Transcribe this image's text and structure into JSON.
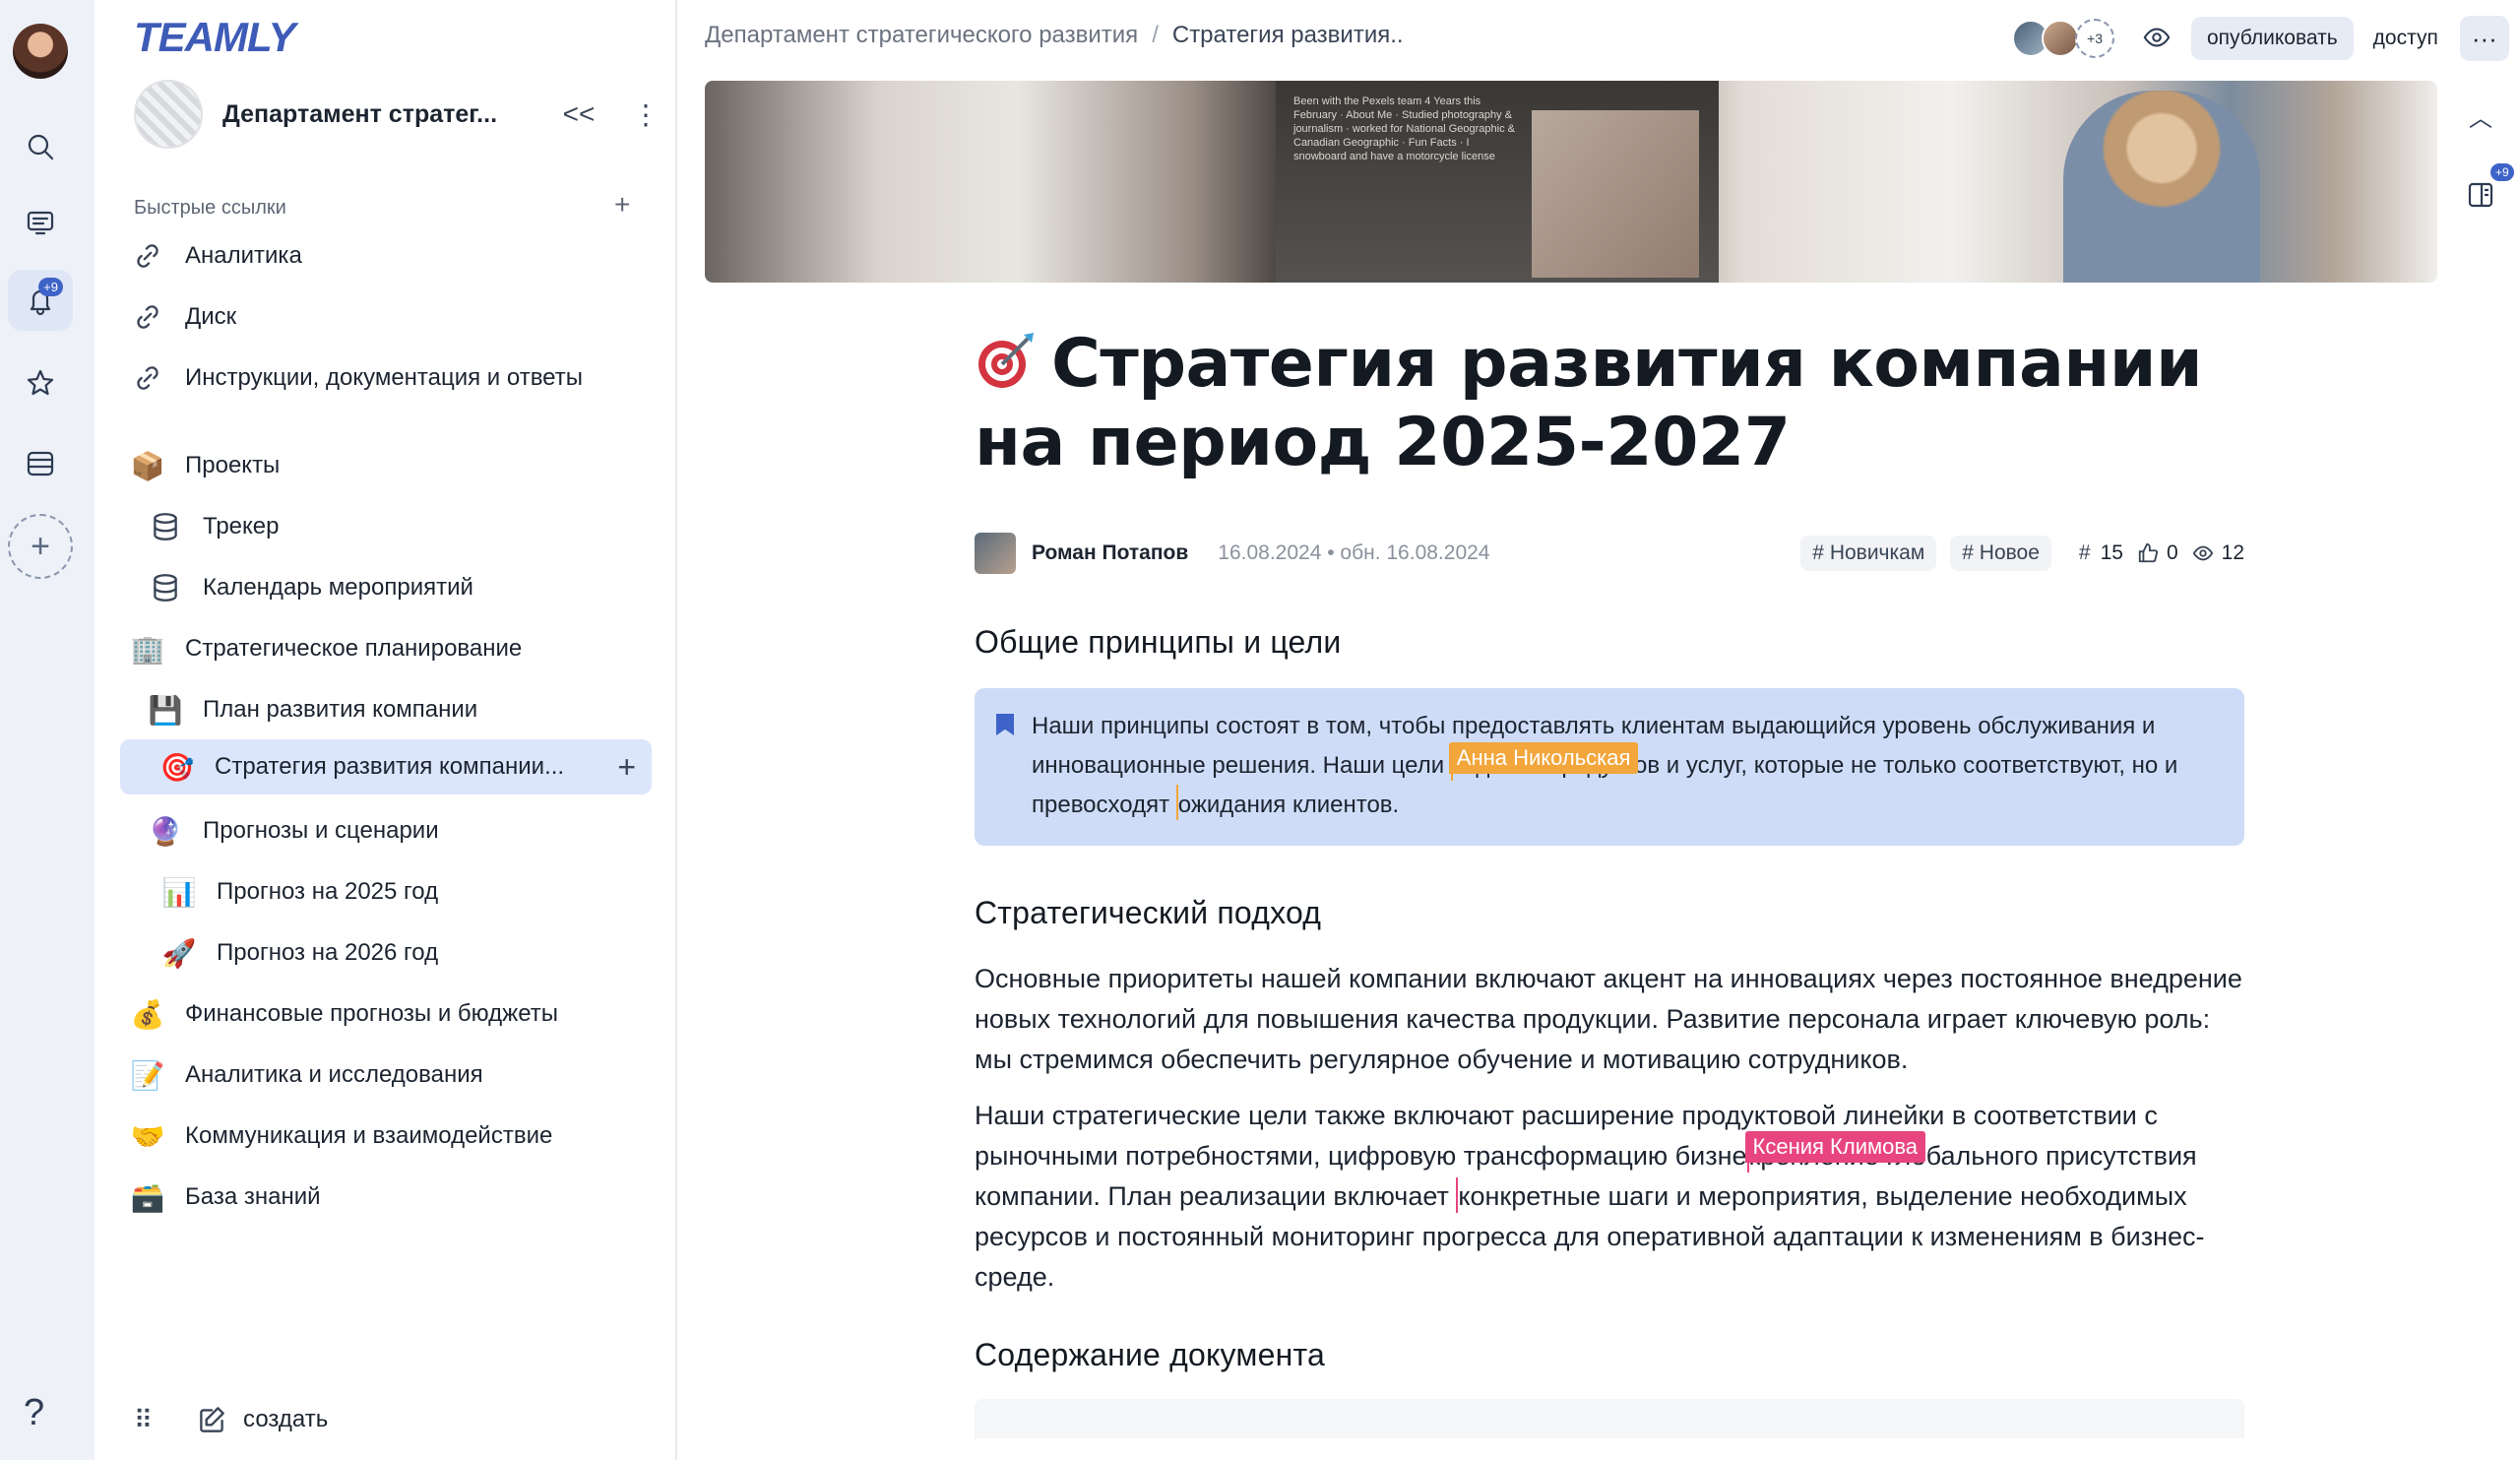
{
  "app": {
    "logo": "TEAMLY"
  },
  "rail": {
    "notifications_badge": "+9",
    "help_label": "?"
  },
  "sidebar": {
    "workspace_name": "Департамент стратег...",
    "collapse_label": "<<",
    "more_label": "⋮",
    "quick_links_label": "Быстрые ссылки",
    "quick_links_add": "+",
    "quick_links": [
      {
        "label": "Аналитика"
      },
      {
        "label": "Диск"
      },
      {
        "label": "Инструкции, документация и ответы"
      }
    ],
    "tree": [
      {
        "label": "Проекты",
        "icon": "📦"
      },
      {
        "label": "Трекер",
        "icon": "database-icon"
      },
      {
        "label": "Календарь мероприятий",
        "icon": "database-icon"
      },
      {
        "label": "Стратегическое планирование",
        "icon": "🏢"
      },
      {
        "label": "План развития компании",
        "icon": "💾"
      },
      {
        "label": "Стратегия развития компании...",
        "icon": "🎯",
        "add": "+"
      },
      {
        "label": "Прогнозы и сценарии",
        "icon": "🔮"
      },
      {
        "label": "Прогноз на 2025 год",
        "icon": "📊"
      },
      {
        "label": "Прогноз на 2026 год",
        "icon": "🚀"
      },
      {
        "label": "Финансовые прогнозы и бюджеты",
        "icon": "💰"
      },
      {
        "label": "Аналитика и исследования",
        "icon": "📝"
      },
      {
        "label": "Коммуникация и взаимодействие",
        "icon": "🤝"
      },
      {
        "label": "База знаний",
        "icon": "🗃️"
      }
    ],
    "footer_create": "создать"
  },
  "topbar": {
    "breadcrumb_root": "Департамент стратегического развития",
    "breadcrumb_sep": "/",
    "breadcrumb_current": "Стратегия развития..",
    "viewers_more": "+3",
    "publish_label": "опубликовать",
    "access_label": "доступ",
    "more_label": "···",
    "panel_badge": "+9"
  },
  "cover": {
    "slide_text": "Been with the Pexels team 4 Years this February · About Me · Studied photography & journalism · worked for National Geographic & Canadian Geographic · Fun Facts · I snowboard and have a motorcycle license"
  },
  "doc": {
    "title": "Стратегия развития компании на период 2025-2027",
    "author": "Роман Потапов",
    "date": "16.08.2024 • обн. 16.08.2024",
    "tags": [
      "Новичкам",
      "Новое"
    ],
    "comments_count": "15",
    "likes_count": "0",
    "views_count": "12",
    "h_principles": "Общие принципы и цели",
    "callout_part1": "Наши принципы состоят в том, чтобы предоставлять клиентам выдающийся уровень обслуживания и инновационные решения. Наши цели ",
    "callout_part2": "оздание продуктов и услуг, которые не только соответствуют, но и превосходят ",
    "callout_part3": "ожидания клиентов.",
    "cursor_orange_name": "Анна Никольская",
    "h_approach": "Стратегический подход",
    "para1": "Основные приоритеты нашей компании включают акцент на инновациях через постоянное внедрение новых технологий для повышения качества продукции. Развитие персонала играет ключевую роль: мы стремимся обеспечить регулярное обучение и мотивацию сотрудников.",
    "para2_part1": "Наши стратегические цели также включают расширение продуктовой линейки в соответствии с рыночными потребностями, цифровую трансформацию бизне",
    "para2_part2": "крепление глобального присутствия компании. План реализации включает ",
    "para2_part3": "конкретные шаги и мероприятия, выделение необходимых ресурсов и постоянный мониторинг прогресса для оперативной адаптации к изменениям в бизнес-среде.",
    "cursor_pink_name": "Ксения Климова",
    "h_contents": "Содержание документа"
  },
  "colors": {
    "accent": "#3e63c8",
    "callout_bg": "#cfdcf7",
    "sidebar_active": "#dbe5fb",
    "cursor_orange": "#f2a63b",
    "cursor_pink": "#e8457f"
  }
}
